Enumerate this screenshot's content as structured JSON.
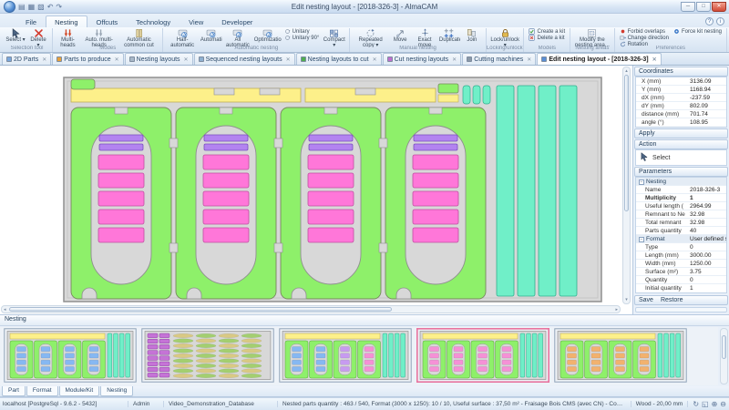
{
  "window": {
    "title": "Edit nesting layout  - [2018-326-3] - AlmaCAM",
    "quick_access": [
      "import-icon",
      "window-icon",
      "tiles-icon",
      "undo-icon",
      "redo-icon"
    ],
    "help_label": "?",
    "info_label": "i"
  },
  "menu_tabs": [
    {
      "label": "File",
      "active": false
    },
    {
      "label": "Nesting",
      "active": true
    },
    {
      "label": "Offcuts",
      "active": false
    },
    {
      "label": "Technology",
      "active": false
    },
    {
      "label": "View",
      "active": false
    },
    {
      "label": "Developer",
      "active": false
    }
  ],
  "ribbon": {
    "groups": [
      {
        "label": "Selection tool",
        "items": [
          {
            "label": "Select",
            "icon": "cursor",
            "arrow": true
          },
          {
            "label": "Delete",
            "icon": "delete-x",
            "arrow": true
          }
        ]
      },
      {
        "label": "Modes",
        "items": [
          {
            "label": "Multi-heads",
            "icon": "multiheads-red"
          },
          {
            "label": "Auto. multi-heads",
            "icon": "multiheads-gray"
          },
          {
            "label": "Automatic common cut",
            "icon": "common-cut"
          }
        ]
      },
      {
        "label": "Automatic nesting",
        "items": [
          {
            "label": "Half-automatic",
            "icon": "machine"
          },
          {
            "label": "Automatic",
            "icon": "machine"
          },
          {
            "label": "All automatic",
            "icon": "machine"
          },
          {
            "label": "Optimization",
            "icon": "machine"
          },
          {
            "stack": [
              {
                "label": "Unitary",
                "icon": "unitary"
              },
              {
                "label": "Unitary 90°",
                "icon": "unitary"
              }
            ]
          },
          {
            "label": "Compact",
            "icon": "compact",
            "arrow": true
          }
        ]
      },
      {
        "label": "Manual nesting",
        "items": [
          {
            "label": "Repeated copy",
            "icon": "repeat-copy",
            "arrow": true
          },
          {
            "label": "Move",
            "icon": "move"
          },
          {
            "label": "Exact move",
            "icon": "exact-move"
          },
          {
            "label": "Duplicate",
            "icon": "duplicate"
          },
          {
            "label": "Join",
            "icon": "join"
          }
        ]
      },
      {
        "label": "Locking/unlocking",
        "items": [
          {
            "label": "Lock/unlock",
            "icon": "lock",
            "arrow": true
          }
        ]
      },
      {
        "label": "Models",
        "items": [
          {
            "stack": [
              {
                "label": "Create a kit",
                "icon": "kit-create"
              },
              {
                "label": "Delete a kit",
                "icon": "kit-delete"
              }
            ]
          }
        ]
      },
      {
        "label": "Nesting areas",
        "items": [
          {
            "label": "Modify the nesting area...",
            "icon": "area",
            "arrow": true
          }
        ]
      },
      {
        "label": "Preferences",
        "items": [
          {
            "stack": [
              {
                "label": "Forbid overlaps",
                "icon": "red-dot"
              },
              {
                "label": "Change direction",
                "icon": "change-dir"
              },
              {
                "label": "Rotation",
                "icon": "rotation"
              }
            ]
          },
          {
            "stack": [
              {
                "label": "Force kit nesting",
                "icon": "force-kit"
              }
            ]
          }
        ]
      }
    ]
  },
  "doc_tabs": [
    {
      "label": "2D Parts",
      "icon_color": "#7aa7dc",
      "active": false
    },
    {
      "label": "Parts to produce",
      "icon_color": "#e8a03a",
      "active": false
    },
    {
      "label": "Nesting layouts",
      "icon_color": "#a8b8c8",
      "active": false
    },
    {
      "label": "Sequenced nesting layouts",
      "icon_color": "#8fb0d0",
      "active": false
    },
    {
      "label": "Nesting layouts to cut",
      "icon_color": "#4fae4f",
      "active": false
    },
    {
      "label": "Cut nesting layouts",
      "icon_color": "#c06fd0",
      "active": false
    },
    {
      "label": "Cutting machines",
      "icon_color": "#8a98a8",
      "active": false
    },
    {
      "label": "Edit nesting layout  - [2018-326-3]",
      "icon_color": "#5a8fd6",
      "active": true
    }
  ],
  "coordinates": {
    "title": "Coordinates",
    "rows": [
      {
        "label": "X (mm)",
        "value": "3136.09"
      },
      {
        "label": "Y (mm)",
        "value": "1168.94"
      },
      {
        "label": "dX (mm)",
        "value": "-237.59"
      },
      {
        "label": "dY (mm)",
        "value": "802.09"
      },
      {
        "label": "distance (mm)",
        "value": "701.74"
      },
      {
        "label": "angle (°)",
        "value": "108.95"
      }
    ]
  },
  "apply_label": "Apply",
  "action": {
    "title": "Action",
    "select_label": "Select"
  },
  "parameters": {
    "title": "Parameters",
    "rows": [
      {
        "kind": "group",
        "label": "Nesting",
        "value": ""
      },
      {
        "label": "Name",
        "value": "2018-326-3"
      },
      {
        "label": "Multiplicity",
        "value": "1",
        "bold": true
      },
      {
        "label": "Useful length (",
        "value": "2964.99"
      },
      {
        "label": "Remnant to Ne",
        "value": "32.98"
      },
      {
        "label": "Total remnant",
        "value": "32.98"
      },
      {
        "label": "Parts quantity",
        "value": "40"
      },
      {
        "kind": "group",
        "label": "Format",
        "value": "User defined sheets"
      },
      {
        "label": "Type",
        "value": "0"
      },
      {
        "label": "Length (mm)",
        "value": "3000.00"
      },
      {
        "label": "Width (mm)",
        "value": "1250.00"
      },
      {
        "label": "Surface (m²)",
        "value": "3.75"
      },
      {
        "label": "Quantity",
        "value": "0"
      },
      {
        "label": "Initial quantity",
        "value": "1"
      }
    ]
  },
  "footer_buttons": {
    "save": "Save",
    "restore": "Restore"
  },
  "nesting_panel": {
    "title": "Nesting",
    "thumbnails": [
      {
        "id": "layout-1",
        "type": "panels",
        "part_colors": [
          "#86b8f2",
          "#86b8f2",
          "#86b8f2",
          "#86b8f2"
        ],
        "selected": false
      },
      {
        "id": "layout-2",
        "type": "hatch",
        "selected": false
      },
      {
        "id": "layout-3",
        "type": "panels",
        "part_colors": [
          "#86b8f2",
          "#86b8f2",
          "#c79bf0",
          "#f591d6"
        ],
        "selected": false
      },
      {
        "id": "layout-4",
        "type": "panels",
        "part_colors": [
          "#f591d6",
          "#f591d6",
          "#f591d6",
          "#f591d6"
        ],
        "selected": true
      },
      {
        "id": "layout-5",
        "type": "panels",
        "part_colors": [
          "#f2b26e",
          "#f2b26e",
          "#f2b26e",
          "#f2b26e"
        ],
        "selected": false
      }
    ]
  },
  "bottom_tabs": [
    "Part",
    "Format",
    "Module/Kit",
    "Nesting"
  ],
  "status_bar": {
    "connection": "localhost [PostgreSql - 9.6.2 - 5432]",
    "user": "Admin",
    "database": "Video_Demonstration_Database",
    "summary": "Nested parts quantity : 463 / 540, Format (3000 x 1250): 10 / 10, Useful surface : 37,50 m² - Fraisage Bois CMS (avec CN) - Condition de coupe par défaut",
    "material": "Wood - 20,00 mm"
  },
  "colors": {
    "part_green": "#8ef06a",
    "part_pink": "#ff77d9",
    "part_purple": "#b383f0",
    "offcut_yellow": "#fdf08a",
    "remnant_teal": "#70efc8",
    "sheet_gray": "#d8d8d8",
    "selection": "#e8739f",
    "close_red": "#d04a36"
  }
}
